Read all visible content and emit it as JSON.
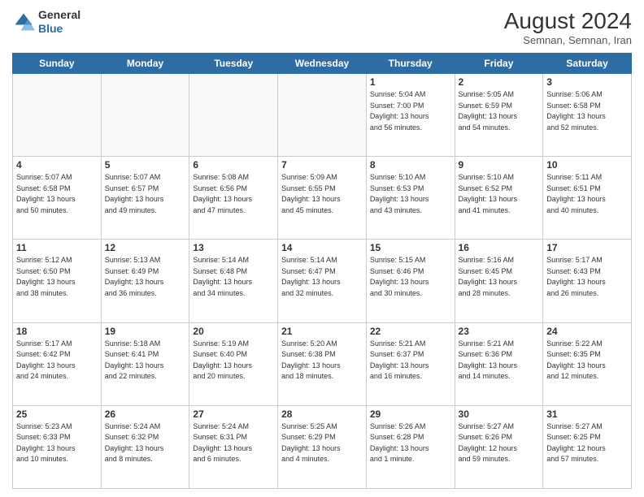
{
  "header": {
    "logo_general": "General",
    "logo_blue": "Blue",
    "main_title": "August 2024",
    "subtitle": "Semnan, Semnan, Iran"
  },
  "weekdays": [
    "Sunday",
    "Monday",
    "Tuesday",
    "Wednesday",
    "Thursday",
    "Friday",
    "Saturday"
  ],
  "weeks": [
    [
      {
        "day": "",
        "info": ""
      },
      {
        "day": "",
        "info": ""
      },
      {
        "day": "",
        "info": ""
      },
      {
        "day": "",
        "info": ""
      },
      {
        "day": "1",
        "info": "Sunrise: 5:04 AM\nSunset: 7:00 PM\nDaylight: 13 hours\nand 56 minutes."
      },
      {
        "day": "2",
        "info": "Sunrise: 5:05 AM\nSunset: 6:59 PM\nDaylight: 13 hours\nand 54 minutes."
      },
      {
        "day": "3",
        "info": "Sunrise: 5:06 AM\nSunset: 6:58 PM\nDaylight: 13 hours\nand 52 minutes."
      }
    ],
    [
      {
        "day": "4",
        "info": "Sunrise: 5:07 AM\nSunset: 6:58 PM\nDaylight: 13 hours\nand 50 minutes."
      },
      {
        "day": "5",
        "info": "Sunrise: 5:07 AM\nSunset: 6:57 PM\nDaylight: 13 hours\nand 49 minutes."
      },
      {
        "day": "6",
        "info": "Sunrise: 5:08 AM\nSunset: 6:56 PM\nDaylight: 13 hours\nand 47 minutes."
      },
      {
        "day": "7",
        "info": "Sunrise: 5:09 AM\nSunset: 6:55 PM\nDaylight: 13 hours\nand 45 minutes."
      },
      {
        "day": "8",
        "info": "Sunrise: 5:10 AM\nSunset: 6:53 PM\nDaylight: 13 hours\nand 43 minutes."
      },
      {
        "day": "9",
        "info": "Sunrise: 5:10 AM\nSunset: 6:52 PM\nDaylight: 13 hours\nand 41 minutes."
      },
      {
        "day": "10",
        "info": "Sunrise: 5:11 AM\nSunset: 6:51 PM\nDaylight: 13 hours\nand 40 minutes."
      }
    ],
    [
      {
        "day": "11",
        "info": "Sunrise: 5:12 AM\nSunset: 6:50 PM\nDaylight: 13 hours\nand 38 minutes."
      },
      {
        "day": "12",
        "info": "Sunrise: 5:13 AM\nSunset: 6:49 PM\nDaylight: 13 hours\nand 36 minutes."
      },
      {
        "day": "13",
        "info": "Sunrise: 5:14 AM\nSunset: 6:48 PM\nDaylight: 13 hours\nand 34 minutes."
      },
      {
        "day": "14",
        "info": "Sunrise: 5:14 AM\nSunset: 6:47 PM\nDaylight: 13 hours\nand 32 minutes."
      },
      {
        "day": "15",
        "info": "Sunrise: 5:15 AM\nSunset: 6:46 PM\nDaylight: 13 hours\nand 30 minutes."
      },
      {
        "day": "16",
        "info": "Sunrise: 5:16 AM\nSunset: 6:45 PM\nDaylight: 13 hours\nand 28 minutes."
      },
      {
        "day": "17",
        "info": "Sunrise: 5:17 AM\nSunset: 6:43 PM\nDaylight: 13 hours\nand 26 minutes."
      }
    ],
    [
      {
        "day": "18",
        "info": "Sunrise: 5:17 AM\nSunset: 6:42 PM\nDaylight: 13 hours\nand 24 minutes."
      },
      {
        "day": "19",
        "info": "Sunrise: 5:18 AM\nSunset: 6:41 PM\nDaylight: 13 hours\nand 22 minutes."
      },
      {
        "day": "20",
        "info": "Sunrise: 5:19 AM\nSunset: 6:40 PM\nDaylight: 13 hours\nand 20 minutes."
      },
      {
        "day": "21",
        "info": "Sunrise: 5:20 AM\nSunset: 6:38 PM\nDaylight: 13 hours\nand 18 minutes."
      },
      {
        "day": "22",
        "info": "Sunrise: 5:21 AM\nSunset: 6:37 PM\nDaylight: 13 hours\nand 16 minutes."
      },
      {
        "day": "23",
        "info": "Sunrise: 5:21 AM\nSunset: 6:36 PM\nDaylight: 13 hours\nand 14 minutes."
      },
      {
        "day": "24",
        "info": "Sunrise: 5:22 AM\nSunset: 6:35 PM\nDaylight: 13 hours\nand 12 minutes."
      }
    ],
    [
      {
        "day": "25",
        "info": "Sunrise: 5:23 AM\nSunset: 6:33 PM\nDaylight: 13 hours\nand 10 minutes."
      },
      {
        "day": "26",
        "info": "Sunrise: 5:24 AM\nSunset: 6:32 PM\nDaylight: 13 hours\nand 8 minutes."
      },
      {
        "day": "27",
        "info": "Sunrise: 5:24 AM\nSunset: 6:31 PM\nDaylight: 13 hours\nand 6 minutes."
      },
      {
        "day": "28",
        "info": "Sunrise: 5:25 AM\nSunset: 6:29 PM\nDaylight: 13 hours\nand 4 minutes."
      },
      {
        "day": "29",
        "info": "Sunrise: 5:26 AM\nSunset: 6:28 PM\nDaylight: 13 hours\nand 1 minute."
      },
      {
        "day": "30",
        "info": "Sunrise: 5:27 AM\nSunset: 6:26 PM\nDaylight: 12 hours\nand 59 minutes."
      },
      {
        "day": "31",
        "info": "Sunrise: 5:27 AM\nSunset: 6:25 PM\nDaylight: 12 hours\nand 57 minutes."
      }
    ]
  ]
}
